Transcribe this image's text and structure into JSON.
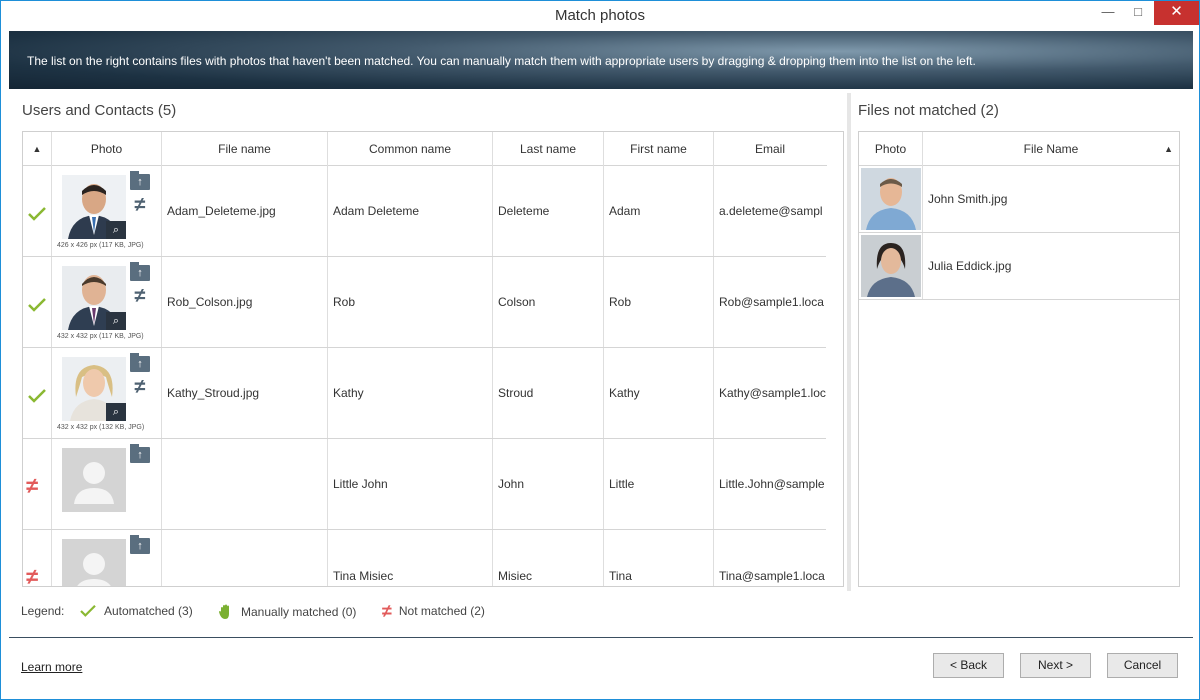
{
  "window": {
    "title": "Match photos",
    "minimize_glyph": "—",
    "maximize_glyph": "□",
    "close_glyph": "✕"
  },
  "banner": {
    "text": "The list on the right contains files with photos that haven't been matched. You can manually match them with appropriate users by dragging & dropping them into the list on the left."
  },
  "users_panel": {
    "title": "Users and Contacts (5)",
    "columns": {
      "sort": "▲",
      "photo": "Photo",
      "file_name": "File name",
      "common_name": "Common name",
      "last_name": "Last name",
      "first_name": "First name",
      "email": "Email"
    },
    "rows": [
      {
        "status": "automatched",
        "photo_caption": "426 x 426 px (117 KB, JPG)",
        "file_name": "Adam_Deleteme.jpg",
        "common_name": "Adam Deleteme",
        "last_name": "Deleteme",
        "first_name": "Adam",
        "email": "a.deleteme@sampl"
      },
      {
        "status": "automatched",
        "photo_caption": "432 x 432 px (117 KB, JPG)",
        "file_name": "Rob_Colson.jpg",
        "common_name": "Rob",
        "last_name": "Colson",
        "first_name": "Rob",
        "email": "Rob@sample1.loca"
      },
      {
        "status": "automatched",
        "photo_caption": "432 x 432 px (132 KB, JPG)",
        "file_name": "Kathy_Stroud.jpg",
        "common_name": "Kathy",
        "last_name": "Stroud",
        "first_name": "Kathy",
        "email": "Kathy@sample1.loc"
      },
      {
        "status": "not_matched",
        "photo_caption": "",
        "file_name": "",
        "common_name": "Little John",
        "last_name": "John",
        "first_name": "Little",
        "email": "Little.John@sample"
      },
      {
        "status": "not_matched",
        "photo_caption": "",
        "file_name": "",
        "common_name": "Tina Misiec",
        "last_name": "Misiec",
        "first_name": "Tina",
        "email": "Tina@sample1.loca"
      }
    ]
  },
  "files_panel": {
    "title": "Files not matched (2)",
    "columns": {
      "photo": "Photo",
      "file_name": "File Name",
      "sort": "▲"
    },
    "rows": [
      {
        "file_name": "John Smith.jpg"
      },
      {
        "file_name": "Julia Eddick.jpg"
      }
    ]
  },
  "legend": {
    "label": "Legend:",
    "automatched": "Automatched (3)",
    "manual": "Manually matched (0)",
    "not_matched": "Not matched (2)"
  },
  "footer": {
    "learn_more": "Learn more",
    "back": "< Back",
    "next": "Next >",
    "cancel": "Cancel"
  },
  "colors": {
    "accent_border": "#1e8fd8",
    "automatched": "#8ab832",
    "not_matched": "#e25b5b",
    "close_button": "#c7312f"
  }
}
